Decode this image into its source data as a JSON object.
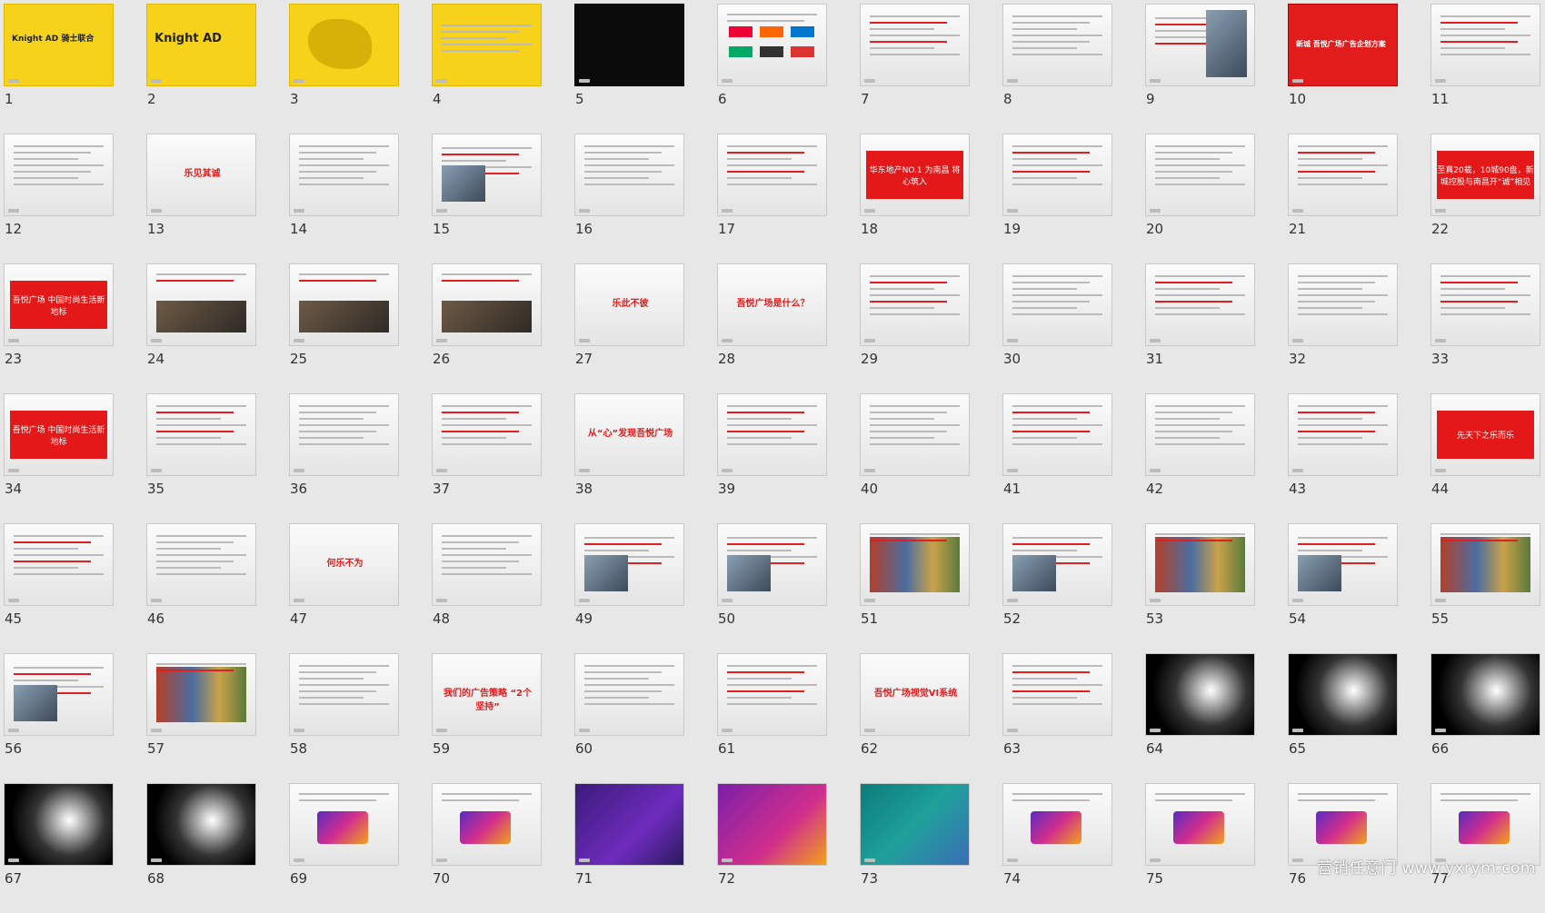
{
  "watermark": "营销任意门 www.yxrym.com",
  "colors": {
    "accent_red": "#e21b1b",
    "brand_yellow": "#f7d21a",
    "background": "#e7e7e7"
  },
  "slides": [
    {
      "n": "1",
      "style": "yellow",
      "title": "Knight AD 骑士联合"
    },
    {
      "n": "2",
      "style": "yellow",
      "title": "Knight AD"
    },
    {
      "n": "3",
      "style": "yellow-map",
      "title": ""
    },
    {
      "n": "4",
      "style": "yellow-tree",
      "title": ""
    },
    {
      "n": "5",
      "style": "black-list",
      "title": ""
    },
    {
      "n": "6",
      "style": "logos",
      "title": ""
    },
    {
      "n": "7",
      "style": "text",
      "title": ""
    },
    {
      "n": "8",
      "style": "text",
      "title": ""
    },
    {
      "n": "9",
      "style": "text-photo",
      "title": ""
    },
    {
      "n": "10",
      "style": "red",
      "title": "新城 吾悦广场广告企划方案"
    },
    {
      "n": "11",
      "style": "text",
      "title": ""
    },
    {
      "n": "12",
      "style": "text",
      "title": ""
    },
    {
      "n": "13",
      "style": "text-red",
      "title": "乐见其诚"
    },
    {
      "n": "14",
      "style": "text",
      "title": ""
    },
    {
      "n": "15",
      "style": "text-image",
      "title": ""
    },
    {
      "n": "16",
      "style": "text",
      "title": ""
    },
    {
      "n": "17",
      "style": "text",
      "title": ""
    },
    {
      "n": "18",
      "style": "bigred",
      "title": "华东地产NO.1 为南昌 将心筑入"
    },
    {
      "n": "19",
      "style": "text",
      "title": ""
    },
    {
      "n": "20",
      "style": "text",
      "title": ""
    },
    {
      "n": "21",
      "style": "text",
      "title": ""
    },
    {
      "n": "22",
      "style": "bigred",
      "title": "至真20载，10城90盘，新城控股与南昌开“诚”相见"
    },
    {
      "n": "23",
      "style": "bigred",
      "title": "吾悦广场 中国时尚生活新地标"
    },
    {
      "n": "24",
      "style": "photo",
      "title": ""
    },
    {
      "n": "25",
      "style": "photo",
      "title": ""
    },
    {
      "n": "26",
      "style": "photo",
      "title": ""
    },
    {
      "n": "27",
      "style": "text-red",
      "title": "乐此不彼"
    },
    {
      "n": "28",
      "style": "text",
      "title": "吾悦广场是什么？"
    },
    {
      "n": "29",
      "style": "text",
      "title": ""
    },
    {
      "n": "30",
      "style": "text",
      "title": ""
    },
    {
      "n": "31",
      "style": "text",
      "title": ""
    },
    {
      "n": "32",
      "style": "text",
      "title": ""
    },
    {
      "n": "33",
      "style": "text",
      "title": ""
    },
    {
      "n": "34",
      "style": "bigred",
      "title": "吾悦广场 中国时尚生活新地标"
    },
    {
      "n": "35",
      "style": "text",
      "title": ""
    },
    {
      "n": "36",
      "style": "text",
      "title": ""
    },
    {
      "n": "37",
      "style": "text",
      "title": ""
    },
    {
      "n": "38",
      "style": "text-red",
      "title": "从“心”发现吾悦广场"
    },
    {
      "n": "39",
      "style": "text",
      "title": ""
    },
    {
      "n": "40",
      "style": "text",
      "title": ""
    },
    {
      "n": "41",
      "style": "text",
      "title": ""
    },
    {
      "n": "42",
      "style": "text",
      "title": ""
    },
    {
      "n": "43",
      "style": "text",
      "title": ""
    },
    {
      "n": "44",
      "style": "bigred",
      "title": "先天下之乐而乐"
    },
    {
      "n": "45",
      "style": "text",
      "title": ""
    },
    {
      "n": "46",
      "style": "text",
      "title": ""
    },
    {
      "n": "47",
      "style": "text-red",
      "title": "何乐不为"
    },
    {
      "n": "48",
      "style": "text",
      "title": ""
    },
    {
      "n": "49",
      "style": "text-image",
      "title": ""
    },
    {
      "n": "50",
      "style": "text-image",
      "title": ""
    },
    {
      "n": "51",
      "style": "collage",
      "title": ""
    },
    {
      "n": "52",
      "style": "text-image",
      "title": ""
    },
    {
      "n": "53",
      "style": "collage",
      "title": ""
    },
    {
      "n": "54",
      "style": "text-image",
      "title": ""
    },
    {
      "n": "55",
      "style": "collage",
      "title": ""
    },
    {
      "n": "56",
      "style": "text-image",
      "title": ""
    },
    {
      "n": "57",
      "style": "collage",
      "title": ""
    },
    {
      "n": "58",
      "style": "text",
      "title": ""
    },
    {
      "n": "59",
      "style": "text",
      "title": "我们的广告策略 “2个坚持”"
    },
    {
      "n": "60",
      "style": "text",
      "title": ""
    },
    {
      "n": "61",
      "style": "text",
      "title": ""
    },
    {
      "n": "62",
      "style": "text-red",
      "title": "吾悦广场视觉VI系统"
    },
    {
      "n": "63",
      "style": "text",
      "title": ""
    },
    {
      "n": "64",
      "style": "photo-dark",
      "title": ""
    },
    {
      "n": "65",
      "style": "photo-dark",
      "title": ""
    },
    {
      "n": "66",
      "style": "photo-dark",
      "title": ""
    },
    {
      "n": "67",
      "style": "photo-dark",
      "title": ""
    },
    {
      "n": "68",
      "style": "photo-dark",
      "title": ""
    },
    {
      "n": "69",
      "style": "vi",
      "title": ""
    },
    {
      "n": "70",
      "style": "vi",
      "title": ""
    },
    {
      "n": "71",
      "style": "purple",
      "title": ""
    },
    {
      "n": "72",
      "style": "magenta",
      "title": ""
    },
    {
      "n": "73",
      "style": "teal",
      "title": ""
    },
    {
      "n": "74",
      "style": "vi",
      "title": ""
    },
    {
      "n": "75",
      "style": "vi",
      "title": ""
    },
    {
      "n": "76",
      "style": "vi",
      "title": ""
    },
    {
      "n": "77",
      "style": "vi",
      "title": ""
    }
  ]
}
